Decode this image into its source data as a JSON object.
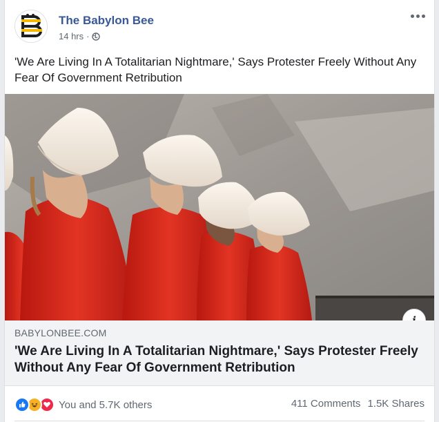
{
  "post": {
    "page_name": "The Babylon Bee",
    "time": "14 hrs",
    "separator": "·",
    "privacy_icon": "globe-icon",
    "text": "'We Are Living In A Totalitarian Nightmare,' Says Protester Freely Without Any Fear Of Government Retribution"
  },
  "link": {
    "domain": "BABYLONBEE.COM",
    "title": "'We Are Living In A Totalitarian Nightmare,' Says Protester Freely Without Any Fear Of Government Retribution",
    "info_icon": "i"
  },
  "footer": {
    "reactions": [
      "like-icon",
      "haha-icon",
      "love-icon"
    ],
    "reactions_text": "You and 5.7K others",
    "comments": "411 Comments",
    "shares": "1.5K Shares"
  },
  "colors": {
    "link_blue": "#385898",
    "like_blue": "#1877f2",
    "haha_yellow": "#f7b125",
    "love_red": "#f0284a",
    "robe_red": "#d8261c",
    "bonnet_white": "#f3ece3"
  }
}
